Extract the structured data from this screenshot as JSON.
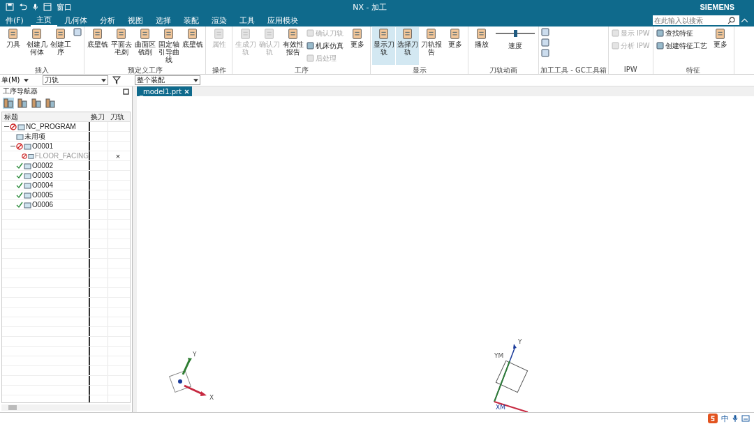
{
  "window": {
    "title": "NX - 加工",
    "brand": "SIEMENS",
    "quick_access": {
      "window_menu": "窗口"
    }
  },
  "menu_tabs": [
    {
      "label": "件(F)",
      "selected": false
    },
    {
      "label": "主页",
      "selected": true
    },
    {
      "label": "几何体",
      "selected": false
    },
    {
      "label": "分析",
      "selected": false
    },
    {
      "label": "视图",
      "selected": false
    },
    {
      "label": "选择",
      "selected": false
    },
    {
      "label": "装配",
      "selected": false
    },
    {
      "label": "渲染",
      "selected": false
    },
    {
      "label": "工具",
      "selected": false
    },
    {
      "label": "应用模块",
      "selected": false
    }
  ],
  "search": {
    "placeholder": "在此输入以搜索"
  },
  "ribbon_groups": [
    {
      "label": "插入",
      "items": [
        {
          "kind": "large",
          "label": "刀具",
          "disabled": false,
          "selected": false
        },
        {
          "kind": "large",
          "label": "创建几何体",
          "disabled": false,
          "selected": false
        },
        {
          "kind": "large",
          "label": "创建工序",
          "disabled": false,
          "selected": false
        },
        {
          "kind": "icon"
        }
      ]
    },
    {
      "label": "预定义工序",
      "items": [
        {
          "kind": "large",
          "label": "底壁铣",
          "disabled": false,
          "selected": false
        },
        {
          "kind": "large",
          "label": "平面去毛刺",
          "disabled": false,
          "selected": false
        },
        {
          "kind": "large",
          "label": "曲面区铣削",
          "disabled": false,
          "selected": false
        },
        {
          "kind": "large",
          "label": "固定轴引导曲线",
          "disabled": false,
          "selected": false
        },
        {
          "kind": "large",
          "label": "底壁铣",
          "disabled": false,
          "selected": false
        }
      ]
    },
    {
      "label": "操作",
      "items": [
        {
          "kind": "large",
          "label": "属性",
          "disabled": true,
          "selected": false
        }
      ]
    },
    {
      "label": "工序",
      "items": [
        {
          "kind": "large",
          "label": "生成刀轨",
          "disabled": true,
          "selected": false
        },
        {
          "kind": "large",
          "label": "确认刀轨",
          "disabled": true,
          "selected": false
        },
        {
          "kind": "large",
          "label": "有效性报告",
          "disabled": false,
          "selected": false
        },
        {
          "kind": "small",
          "label": "确认刀轨",
          "disabled": true
        },
        {
          "kind": "small",
          "label": "机床仿真",
          "disabled": false
        },
        {
          "kind": "small",
          "label": "后处理",
          "disabled": true
        },
        {
          "kind": "large",
          "label": "更多",
          "disabled": false,
          "selected": false
        }
      ]
    },
    {
      "label": "显示",
      "items": [
        {
          "kind": "large",
          "label": "显示刀轨",
          "disabled": false,
          "selected": true
        },
        {
          "kind": "large",
          "label": "选择刀轨",
          "disabled": false,
          "selected": true
        },
        {
          "kind": "large",
          "label": "刀轨报告",
          "disabled": false,
          "selected": false
        },
        {
          "kind": "large",
          "label": "更多",
          "disabled": false,
          "selected": false
        }
      ]
    },
    {
      "label": "刀轨动画",
      "items": [
        {
          "kind": "large",
          "label": "播放",
          "disabled": false,
          "selected": false
        },
        {
          "kind": "slider",
          "label": "速度",
          "level": 0.5
        }
      ]
    },
    {
      "label": "加工工具 - GC工具箱",
      "items": [
        {
          "kind": "icon"
        },
        {
          "kind": "icon"
        },
        {
          "kind": "icon"
        }
      ]
    },
    {
      "label": "IPW",
      "items": [
        {
          "kind": "small",
          "label": "显示 IPW",
          "disabled": true
        },
        {
          "kind": "small",
          "label": "分析 IPW",
          "disabled": true
        }
      ]
    },
    {
      "label": "特征",
      "items": [
        {
          "kind": "small",
          "label": "查找特征",
          "disabled": false
        },
        {
          "kind": "small",
          "label": "创建特征工艺",
          "disabled": false
        },
        {
          "kind": "large",
          "label": "更多",
          "disabled": false,
          "selected": false
        }
      ]
    }
  ],
  "filter_bar": {
    "menu": "单(M)",
    "type_filter": "刀轨",
    "scope_filter": "整个装配"
  },
  "navigator": {
    "title": "工序导航器",
    "columns": [
      "标题",
      "换刀",
      "刀轨"
    ],
    "tree": [
      {
        "name": "NC_PROGRAM",
        "prohibited": true,
        "complete": false,
        "expanded": true,
        "children": [
          {
            "name": "未用项",
            "prohibited": false,
            "complete": false
          },
          {
            "name": "O0001",
            "prohibited": true,
            "complete": false,
            "expanded": true,
            "children": [
              {
                "name": "FLOOR_FACING",
                "prohibited": true,
                "complete": false,
                "toolpath": "×",
                "dimmed": true
              }
            ]
          },
          {
            "name": "O0002",
            "prohibited": false,
            "complete": true
          },
          {
            "name": "O0003",
            "prohibited": false,
            "complete": true
          },
          {
            "name": "O0004",
            "prohibited": false,
            "complete": true
          },
          {
            "name": "O0005",
            "prohibited": false,
            "complete": true
          },
          {
            "name": "O0006",
            "prohibited": false,
            "complete": true
          }
        ]
      }
    ]
  },
  "document_tab": {
    "label": "_model1.prt"
  },
  "viewport": {
    "wcs_axes": {
      "x": "X",
      "y": "Y"
    },
    "model_axes": {
      "y": "Y",
      "ym": "YM",
      "xm": "XM"
    }
  },
  "tray": {
    "ime": "中"
  }
}
